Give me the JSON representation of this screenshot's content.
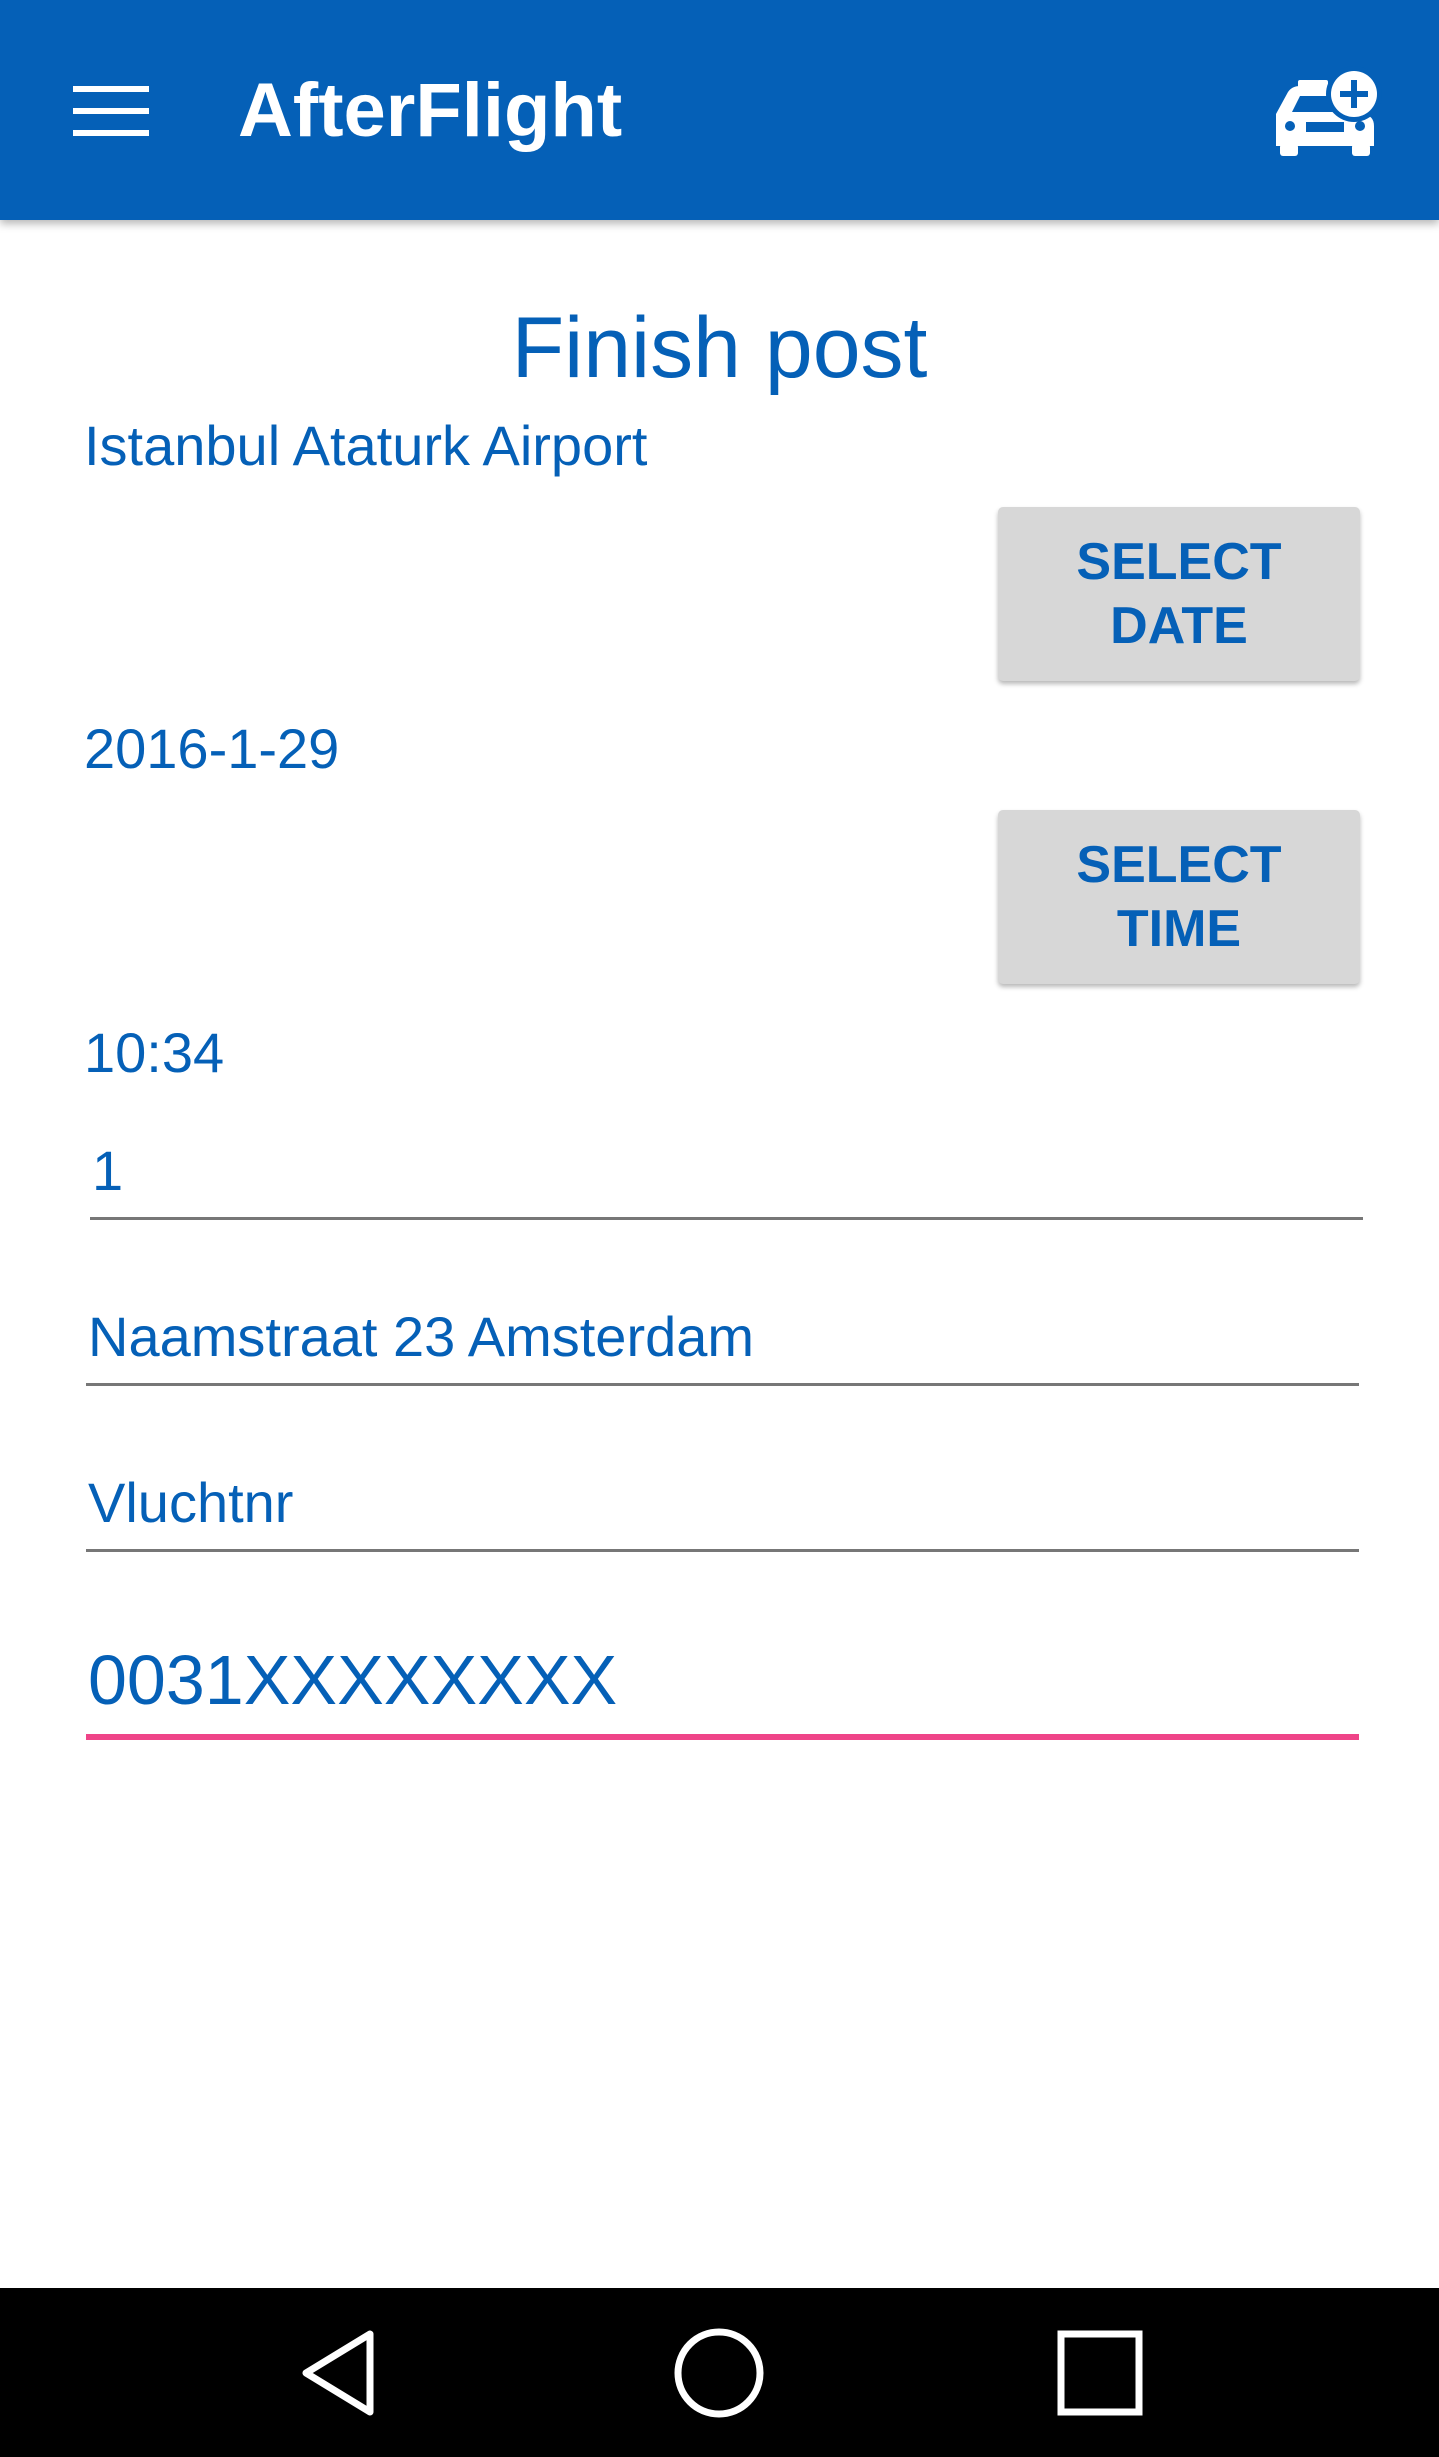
{
  "app_bar": {
    "title": "AfterFlight",
    "menu_icon": "hamburger-menu-icon",
    "action_icon": "add-taxi-icon",
    "background_color": "#0560b7"
  },
  "form": {
    "heading": "Finish post",
    "airport": "Istanbul Ataturk Airport",
    "select_date_label": "SELECT\nDATE",
    "date_value": "2016-1-29",
    "select_time_label": "SELECT\nTIME",
    "time_value": "10:34",
    "passengers_value": "1",
    "address_value": "Naamstraat 23 Amsterdam",
    "flight_number_placeholder": "Vluchtnr",
    "phone_value": "0031XXXXXXXX",
    "accent_color": "#ef4488",
    "text_color": "#0560b7"
  },
  "nav_bar": {
    "back_icon": "back-triangle-icon",
    "home_icon": "home-circle-icon",
    "recents_icon": "recents-square-icon"
  }
}
